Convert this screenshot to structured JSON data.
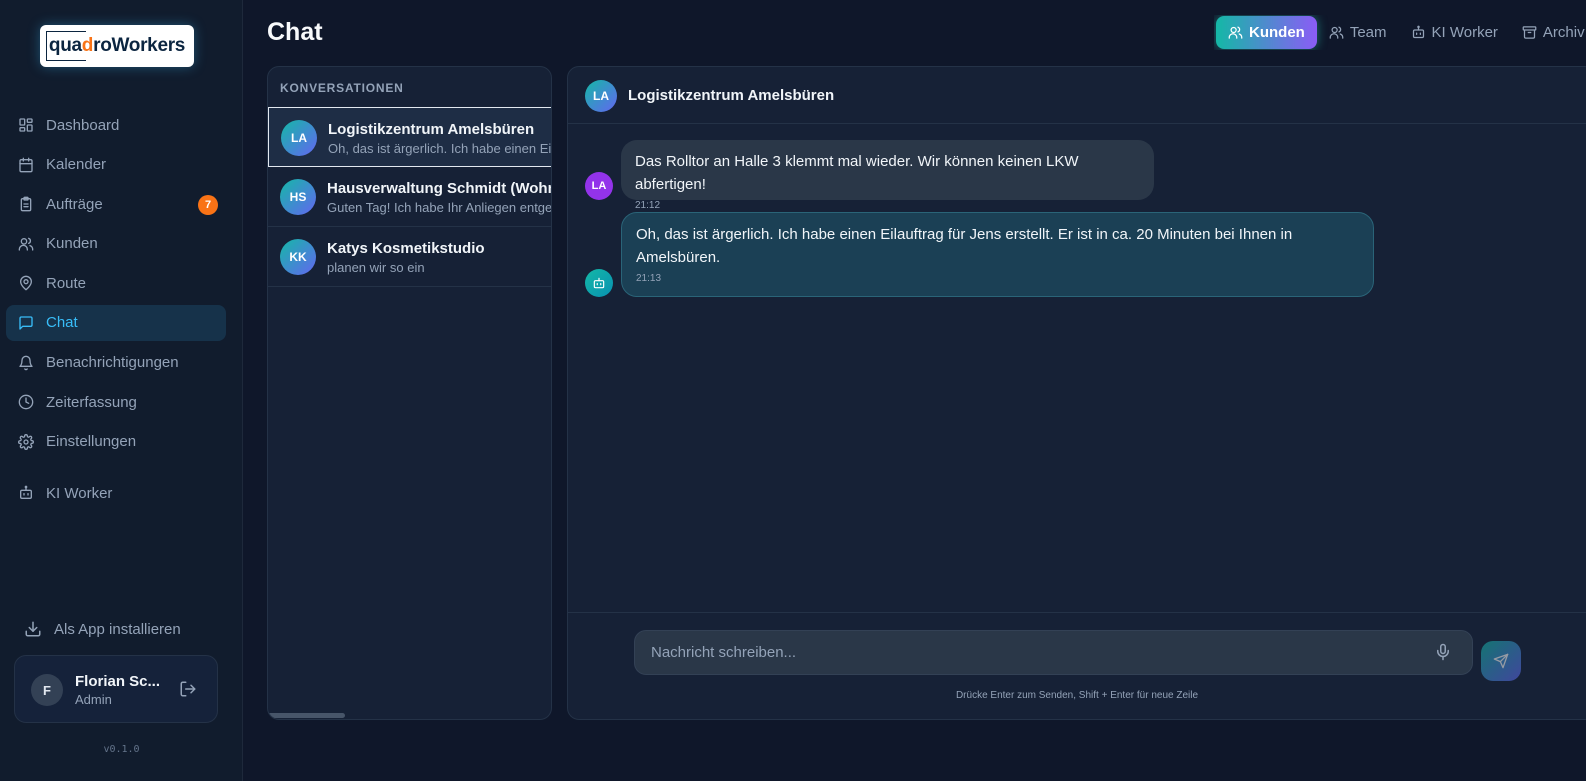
{
  "app": {
    "logo_text_pre": "qua",
    "logo_text_accent": "d",
    "logo_text_post": "roWorkers",
    "version": "v0.1.0"
  },
  "sidebar": {
    "items": [
      {
        "label": "Dashboard",
        "icon": "dashboard-icon"
      },
      {
        "label": "Kalender",
        "icon": "calendar-icon"
      },
      {
        "label": "Aufträge",
        "icon": "clipboard-icon",
        "badge": "7"
      },
      {
        "label": "Kunden",
        "icon": "users-icon"
      },
      {
        "label": "Route",
        "icon": "map-pin-icon"
      },
      {
        "label": "Chat",
        "icon": "message-icon",
        "active": true
      },
      {
        "label": "Benachrichtigungen",
        "icon": "bell-icon"
      },
      {
        "label": "Zeiterfassung",
        "icon": "clock-icon"
      },
      {
        "label": "Einstellungen",
        "icon": "gear-icon"
      },
      {
        "label": "KI Worker",
        "icon": "robot-icon"
      }
    ],
    "install_label": "Als App installieren",
    "user": {
      "initial": "F",
      "name": "Florian Sc...",
      "role": "Admin"
    }
  },
  "header": {
    "title": "Chat",
    "tabs": [
      {
        "label": "Kunden",
        "icon": "users-icon",
        "active": true
      },
      {
        "label": "Team",
        "icon": "users-icon"
      },
      {
        "label": "KI Worker",
        "icon": "robot-icon"
      },
      {
        "label": "Archiv",
        "icon": "archive-icon"
      }
    ]
  },
  "conversations": {
    "header": "KONVERSATIONEN",
    "items": [
      {
        "initials": "LA",
        "name": "Logistikzentrum Amelsbüren",
        "preview": "Oh, das ist ärgerlich. Ich habe einen Eilauftrag",
        "active": true
      },
      {
        "initials": "HS",
        "name": "Hausverwaltung Schmidt (Wohnpark)",
        "preview": "Guten Tag! Ich habe Ihr Anliegen entgegengenommen"
      },
      {
        "initials": "KK",
        "name": "Katys Kosmetikstudio",
        "preview": "planen wir so ein"
      }
    ]
  },
  "chat": {
    "initials": "LA",
    "title": "Logistikzentrum Amelsbüren",
    "messages": [
      {
        "sender": "customer",
        "initials": "LA",
        "text": "Das Rolltor an Halle 3 klemmt mal wieder. Wir können keinen LKW abfertigen!",
        "time": "21:12"
      },
      {
        "sender": "bot",
        "text": "Oh, das ist ärgerlich. Ich habe einen Eilauftrag für Jens erstellt. Er ist in ca. 20 Minuten bei Ihnen in Amelsbüren.",
        "time": "21:13"
      }
    ],
    "input_placeholder": "Nachricht schreiben...",
    "hint": "Drücke Enter zum Senden, Shift + Enter für neue Zeile"
  },
  "colors": {
    "background": "#0f172a",
    "accent": "#38bdf8",
    "badge": "#f97316",
    "customer_avatar": "#9333ea"
  }
}
